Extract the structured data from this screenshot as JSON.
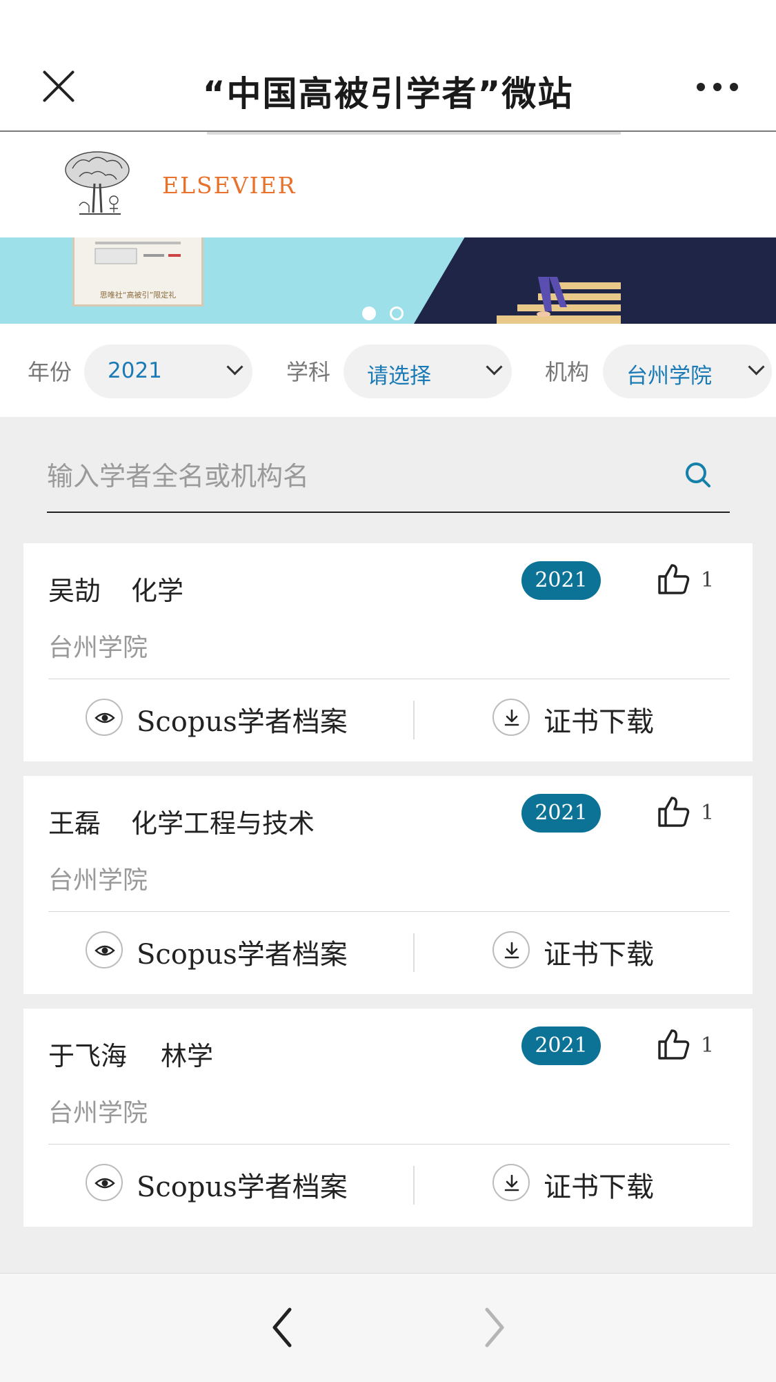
{
  "header": {
    "title": "“中国高被引学者”微站",
    "close_icon": "close-icon",
    "more_icon": "more-icon"
  },
  "banner": {
    "brand": "ELSEVIER",
    "book_caption": "思唯社“高被引”限定礼",
    "slides_total": 2,
    "active_slide": 1,
    "colors": {
      "brand": "#e8712b",
      "sky": "#9de0ea",
      "night": "#1e2546"
    }
  },
  "filters": [
    {
      "label": "年份",
      "value": "2021"
    },
    {
      "label": "学科",
      "value": "请选择"
    },
    {
      "label": "机构",
      "value": "台州学院"
    }
  ],
  "search": {
    "placeholder": "输入学者全名或机构名",
    "icon": "search-icon"
  },
  "scholars": [
    {
      "name": "吴劼",
      "field": "化学",
      "institution": "台州学院",
      "year": "2021",
      "likes": "1"
    },
    {
      "name": "王磊",
      "field": "化学工程与技术",
      "institution": "台州学院",
      "year": "2021",
      "likes": "1"
    },
    {
      "name": "于飞海",
      "field": "林学",
      "institution": "台州学院",
      "year": "2021",
      "likes": "1"
    }
  ],
  "actions": {
    "profile_label": "Scopus学者档案",
    "download_label": "证书下载"
  },
  "colors": {
    "accent_blue": "#1a7ab6",
    "badge": "#0c7396"
  }
}
